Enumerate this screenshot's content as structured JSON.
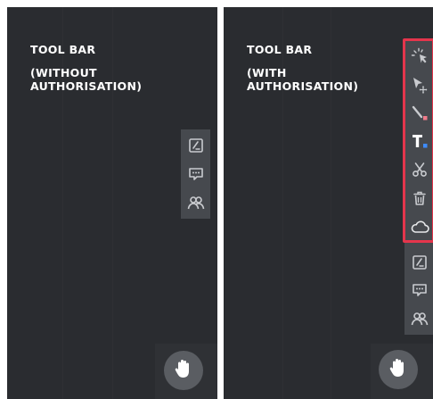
{
  "left_panel": {
    "title": "TOOL BAR",
    "subtitle": "(WITHOUT AUTHORISATION)",
    "tools": [
      "page-edit-icon",
      "comment-icon",
      "people-icon"
    ]
  },
  "right_panel": {
    "title": "TOOL BAR",
    "subtitle": "(WITH AUTHORISATION)",
    "authorised_tools": [
      "laser-pointer-icon",
      "select-move-icon",
      "pen-icon",
      "text-icon",
      "scissors-icon",
      "trash-icon",
      "cloud-icon"
    ],
    "tools": [
      "page-edit-icon",
      "comment-icon",
      "people-icon"
    ]
  },
  "colors": {
    "panel_bg": "#2a2c30",
    "toolbar_bg": "#46494e",
    "highlight": "#e5354c",
    "accent_pink": "#f07a8a",
    "accent_blue": "#3d8bff",
    "icon": "#c9cbcf"
  }
}
